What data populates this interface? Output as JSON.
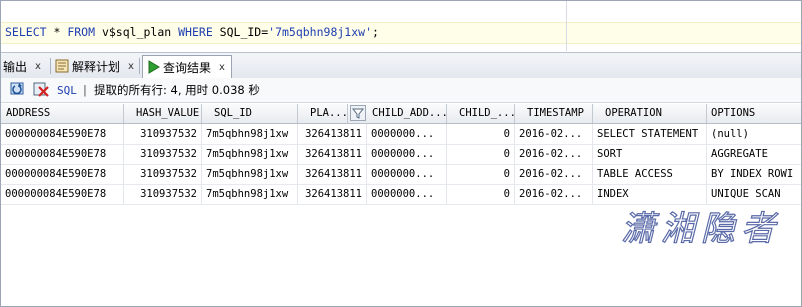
{
  "editor": {
    "sql_parts": [
      "SELECT",
      " * ",
      "FROM",
      " v$sql_plan ",
      "WHERE",
      " SQL_ID=",
      "'7m5qbhn98j1xw'",
      ";"
    ]
  },
  "tabs": [
    {
      "label": "输出",
      "icon": "output-icon",
      "close": "x"
    },
    {
      "label": "解释计划",
      "icon": "explain-plan-icon",
      "close": "x"
    },
    {
      "label": "查询结果",
      "icon": "run-icon",
      "close": "x",
      "active": true
    }
  ],
  "toolbar": {
    "sql_label": "SQL",
    "separator": "|",
    "status_text": "提取的所有行: 4, 用时 0.038 秒"
  },
  "grid": {
    "columns": [
      "ADDRESS",
      "HASH_VALUE",
      "SQL_ID",
      "PLA...",
      "CHILD_ADD...",
      "CHILD_...",
      "TIMESTAMP",
      "OPERATION",
      "OPTIONS"
    ],
    "rows": [
      [
        "000000084E590E78",
        "310937532",
        "7m5qbhn98j1xw",
        "326413811",
        "0000000...",
        "0",
        "2016-02...",
        "SELECT STATEMENT",
        "(null)"
      ],
      [
        "000000084E590E78",
        "310937532",
        "7m5qbhn98j1xw",
        "326413811",
        "0000000...",
        "0",
        "2016-02...",
        "SORT",
        "AGGREGATE"
      ],
      [
        "000000084E590E78",
        "310937532",
        "7m5qbhn98j1xw",
        "326413811",
        "0000000...",
        "0",
        "2016-02...",
        "TABLE ACCESS",
        "BY INDEX ROWI"
      ],
      [
        "000000084E590E78",
        "310937532",
        "7m5qbhn98j1xw",
        "326413811",
        "0000000...",
        "0",
        "2016-02...",
        "INDEX",
        "UNIQUE SCAN"
      ]
    ]
  },
  "watermark": {
    "text": "潇湘隐者"
  },
  "colors": {
    "keyword": "#1f3fb0",
    "sql_line_bg": "#fffee8",
    "accent": "#2e8b2e"
  }
}
